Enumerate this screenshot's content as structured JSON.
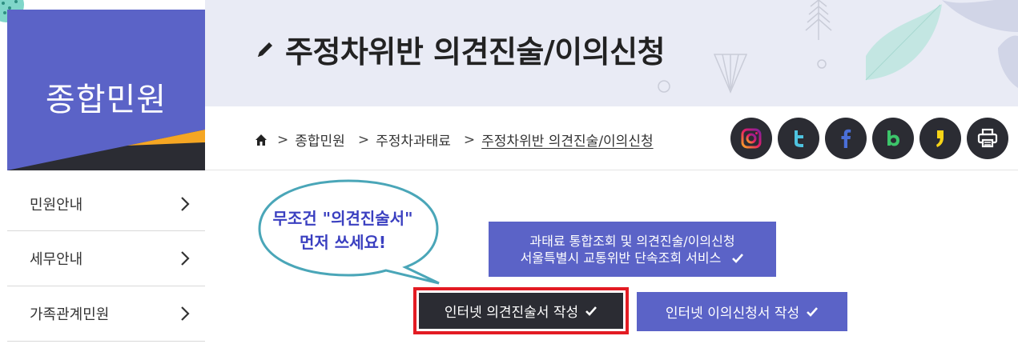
{
  "colors": {
    "brand_purple": "#5b63c7",
    "dark": "#2b2c33",
    "accent_orange": "#f5a623",
    "highlight_red": "#e31b23",
    "bubble_text": "#3a3fc0",
    "bubble_stroke": "#4aa6b8",
    "header_band": "#e9ebf5"
  },
  "header": {
    "title": "주정차위반 의견진술/이의신청",
    "title_icon": "pencil-icon"
  },
  "left_panel": {
    "section_title": "종합민원",
    "menu": [
      {
        "label": "민원안내",
        "icon": "chevron-right-icon"
      },
      {
        "label": "세무안내",
        "icon": "chevron-right-icon"
      },
      {
        "label": "가족관계민원",
        "icon": "chevron-right-icon"
      }
    ]
  },
  "breadcrumb": {
    "home_icon": "home-icon",
    "separator": ">",
    "items": [
      "종합민원",
      "주정차과태료",
      "주정차위반 의견진술/이의신청"
    ]
  },
  "social": [
    {
      "name": "instagram",
      "icon": "instagram-icon"
    },
    {
      "name": "twitter",
      "icon": "twitter-icon"
    },
    {
      "name": "facebook",
      "icon": "facebook-icon"
    },
    {
      "name": "band",
      "icon": "band-icon"
    },
    {
      "name": "kakaostory",
      "icon": "kakaostory-icon"
    },
    {
      "name": "print",
      "icon": "print-icon"
    }
  ],
  "annotation": {
    "line1": "무조건 \"의견진술서\"",
    "line2": "먼저 쓰세요!"
  },
  "buttons": {
    "combined_lookup": {
      "line1": "과태료 통합조회 및 의견진술/이의신청",
      "line2": "서울특별시 교통위반 단속조회 서비스",
      "icon": "check-icon"
    },
    "write_opinion": {
      "label": "인터넷 의견진술서 작성",
      "icon": "check-icon"
    },
    "write_objection": {
      "label": "인터넷 이의신청서 작성",
      "icon": "check-icon"
    }
  }
}
